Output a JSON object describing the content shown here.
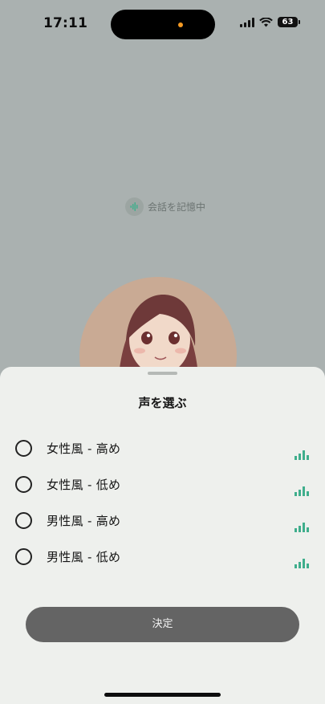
{
  "status_bar": {
    "time": "17:11",
    "battery": "63"
  },
  "background": {
    "memory_label": "会話を記憶中"
  },
  "sheet": {
    "title": "声を選ぶ",
    "options": [
      {
        "label": "女性風 - 高め",
        "selected": false
      },
      {
        "label": "女性風 - 低め",
        "selected": false
      },
      {
        "label": "男性風 - 高め",
        "selected": false
      },
      {
        "label": "男性風 - 低め",
        "selected": false
      }
    ],
    "confirm_label": "決定"
  },
  "colors": {
    "accent": "#3fae8c",
    "sheet_bg": "#eef0ed",
    "backdrop": "#aab1b0",
    "button": "#646464"
  }
}
